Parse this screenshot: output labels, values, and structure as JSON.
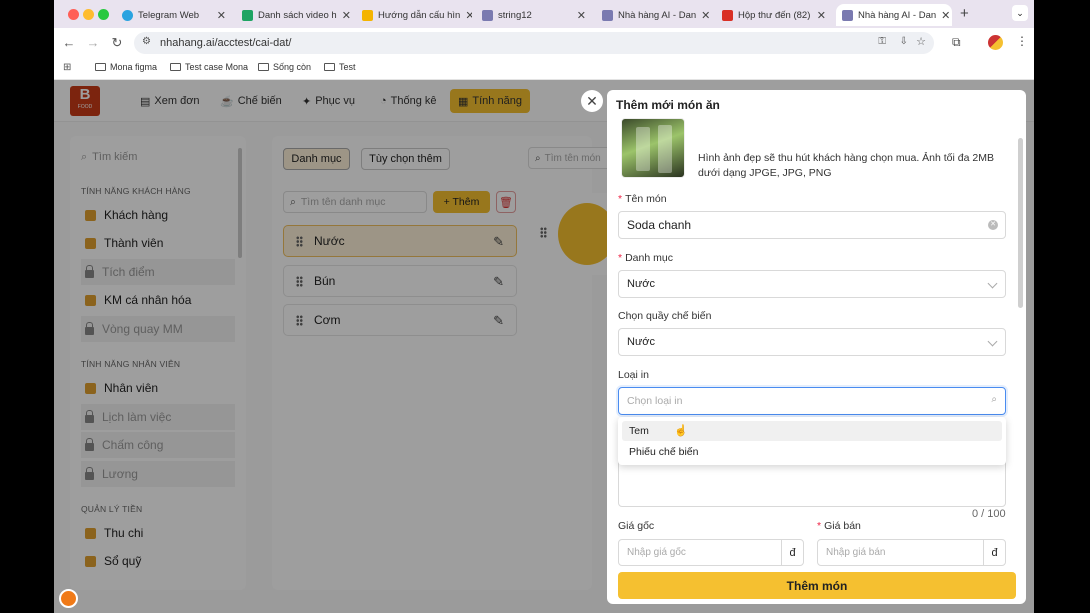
{
  "browser": {
    "tabs": [
      {
        "label": "Telegram Web",
        "color": "#2aa3e0"
      },
      {
        "label": "Danh sách video h",
        "color": "#1fa463"
      },
      {
        "label": "Hướng dẫn cấu hìn",
        "color": "#f4b400"
      },
      {
        "label": "string12",
        "color": "#7a7ab0"
      },
      {
        "label": "Nhà hàng AI - Dan",
        "color": "#7a7ab0"
      },
      {
        "label": "Hộp thư đến (82)",
        "color": "#d93025"
      },
      {
        "label": "Nhà hàng AI - Dan",
        "color": "#7a7ab0"
      }
    ],
    "url": "nhahang.ai/acctest/cai-dat/",
    "bookmarks": [
      "Mona figma",
      "Test case Mona",
      "Sống còn",
      "Test"
    ]
  },
  "header": {
    "logo_text": "B",
    "logo_sub": "FOOD",
    "nav": [
      {
        "label": "Xem đơn",
        "icon": "document-icon"
      },
      {
        "label": "Chế biến",
        "icon": "cook-icon"
      },
      {
        "label": "Phục vụ",
        "icon": "serve-icon"
      },
      {
        "label": "Thống kê",
        "icon": "chart-icon"
      },
      {
        "label": "Tính năng",
        "icon": "grid-icon"
      }
    ]
  },
  "sidebar": {
    "search_placeholder": "Tìm kiếm",
    "sections": [
      {
        "title": "TÍNH NĂNG KHÁCH HÀNG",
        "items": [
          {
            "label": "Khách hàng",
            "locked": false
          },
          {
            "label": "Thành viên",
            "locked": false
          },
          {
            "label": "Tích điểm",
            "locked": true
          },
          {
            "label": "KM cá nhân hóa",
            "locked": false
          },
          {
            "label": "Vòng quay MM",
            "locked": true
          }
        ]
      },
      {
        "title": "TÍNH NĂNG NHÂN VIÊN",
        "items": [
          {
            "label": "Nhân viên",
            "locked": false
          },
          {
            "label": "Lịch làm việc",
            "locked": true
          },
          {
            "label": "Chấm công",
            "locked": true
          },
          {
            "label": "Lương",
            "locked": true
          }
        ]
      },
      {
        "title": "QUẢN LÝ TIỀN",
        "items": [
          {
            "label": "Thu chi",
            "locked": false
          },
          {
            "label": "Sổ quỹ",
            "locked": false
          }
        ]
      }
    ]
  },
  "main": {
    "tabs": [
      "Danh mục",
      "Tùy chọn thêm"
    ],
    "category_search_placeholder": "Tìm tên danh mục",
    "add_button": "+ Thêm",
    "categories": [
      "Nước",
      "Bún",
      "Cơm"
    ],
    "item_search_placeholder": "Tìm tên món"
  },
  "modal": {
    "title": "Thêm mới món ăn",
    "image_hint": "Hình ảnh đẹp sẽ thu hút khách hàng chọn mua. Ảnh tối đa 2MB dưới dạng JPGE, JPG, PNG",
    "fields": {
      "name_label": "Tên món",
      "name_value": "Soda chanh",
      "category_label": "Danh mục",
      "category_value": "Nước",
      "station_label": "Chọn quầy chế biến",
      "station_value": "Nước",
      "print_label": "Loại in",
      "print_placeholder": "Chọn loại in",
      "desc_counter": "0 / 100",
      "cost_label": "Giá gốc",
      "cost_placeholder": "Nhập giá gốc",
      "price_label": "Giá bán",
      "price_placeholder": "Nhập giá bán",
      "currency": "đ"
    },
    "print_options": [
      "Tem",
      "Phiếu chế biến"
    ],
    "submit": "Thêm món"
  }
}
